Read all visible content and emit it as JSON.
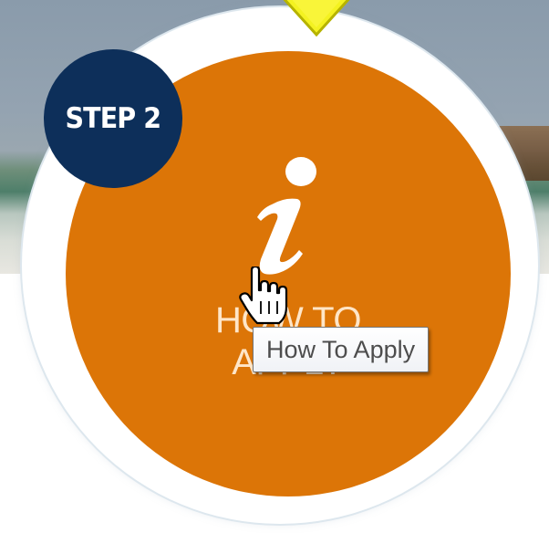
{
  "step_badge": {
    "label": "STEP 2",
    "color": "#0d2f5a"
  },
  "main_button": {
    "icon": "info-icon",
    "label": "HOW TO APPLY",
    "color": "#dc7507"
  },
  "tooltip": {
    "text": "How To Apply"
  },
  "pointer": {
    "icon": "yellow-arrow-icon",
    "color": "#f4f221"
  },
  "cursor": {
    "icon": "hand-pointer-icon"
  }
}
